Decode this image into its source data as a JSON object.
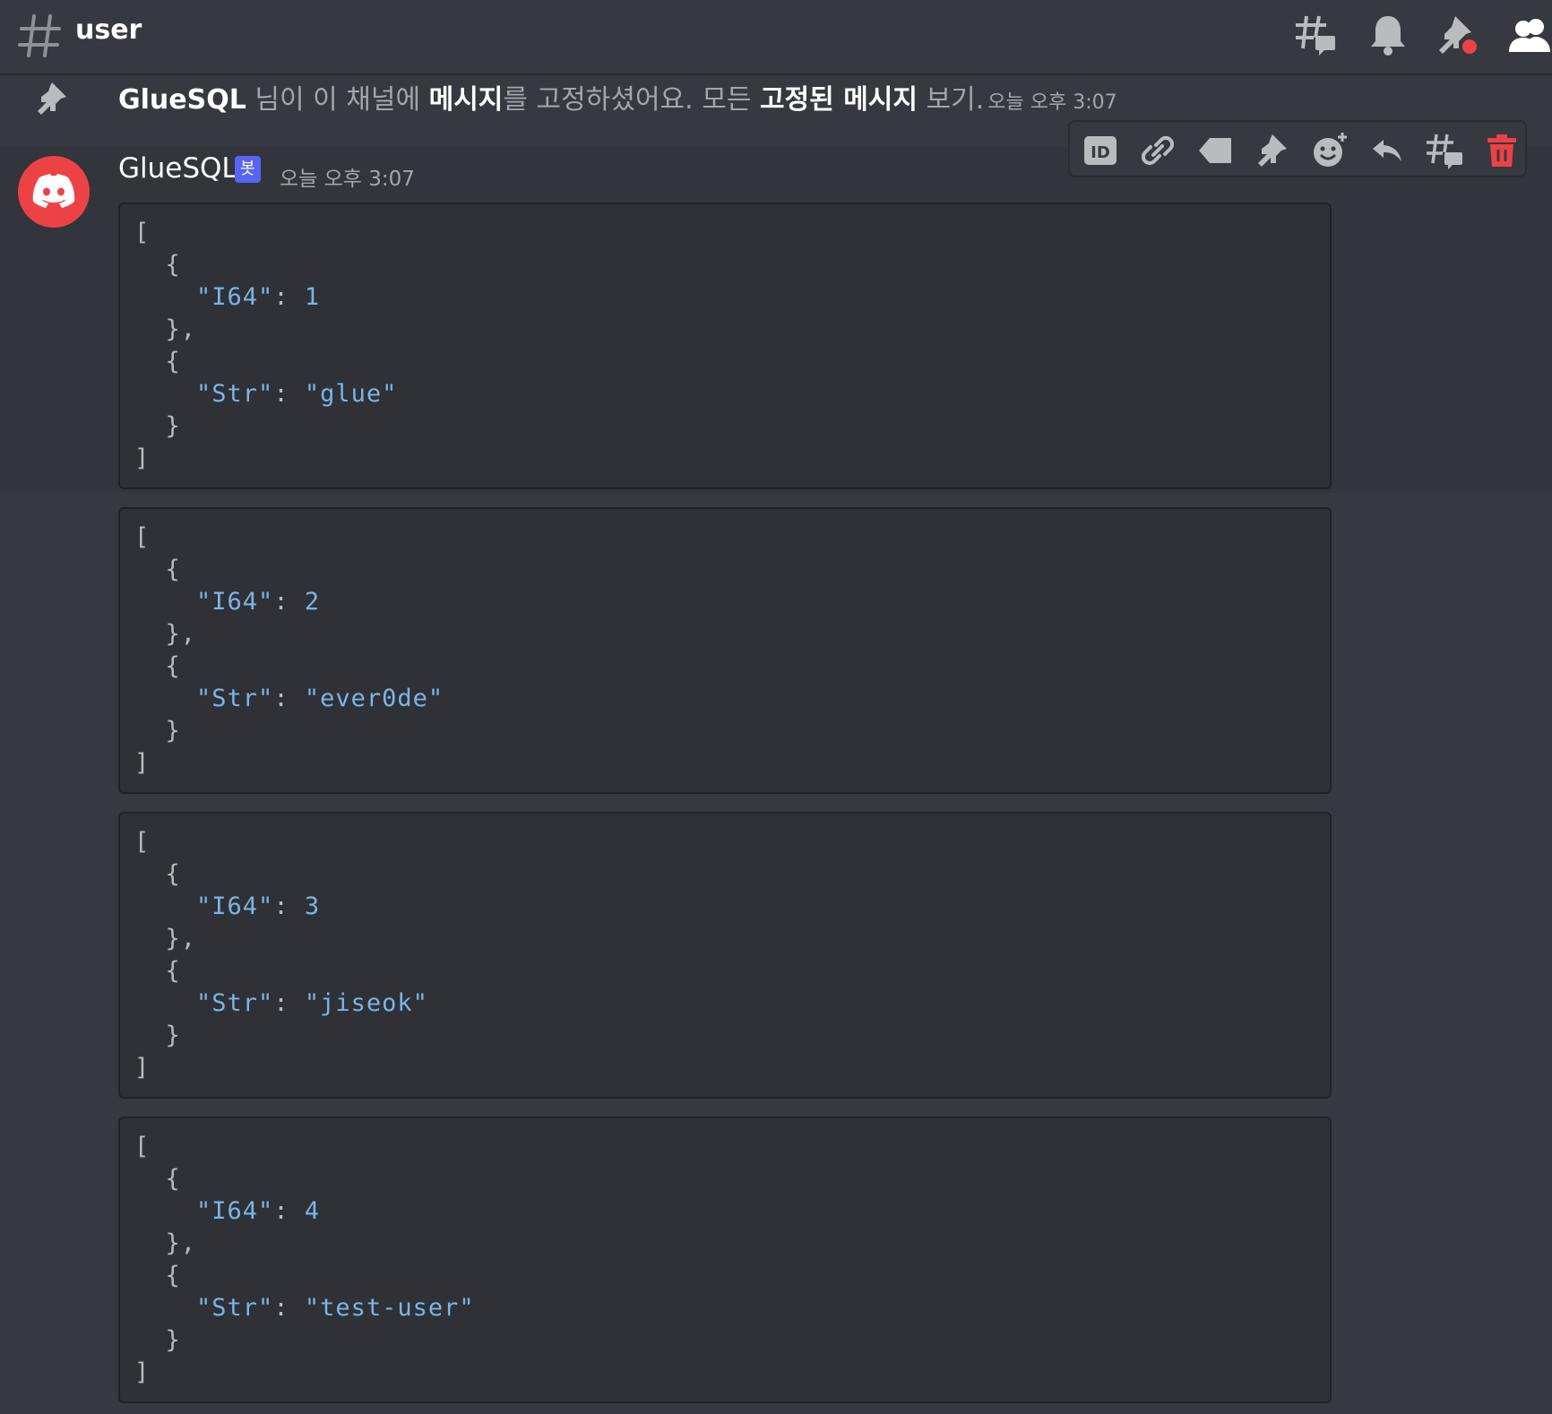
{
  "header": {
    "channel_name": "user"
  },
  "pinned_notice": {
    "author": "GlueSQL",
    "text_1": " 님이 이 채널에 ",
    "link_1": "메시지",
    "text_2": "를 고정하셨어요. 모든 ",
    "link_2": "고정된 메시지",
    "text_3": " 보기.",
    "time": "오늘 오후 3:07"
  },
  "message": {
    "author": "GlueSQL",
    "bot_tag": "봇",
    "time": "오늘 오후 3:07",
    "avatar_color": "#ed4245"
  },
  "toolbar": {
    "icons": [
      "id-icon",
      "link-icon",
      "tag-icon",
      "pin-icon",
      "add-reaction-icon",
      "reply-icon",
      "thread-icon",
      "trash-icon"
    ],
    "danger_color": "#ed4245"
  },
  "code_blocks": [
    {
      "i64_key": "\"I64\"",
      "i64_value": "1",
      "str_key": "\"Str\"",
      "str_value": "\"glue\""
    },
    {
      "i64_key": "\"I64\"",
      "i64_value": "2",
      "str_key": "\"Str\"",
      "str_value": "\"ever0de\""
    },
    {
      "i64_key": "\"I64\"",
      "i64_value": "3",
      "str_key": "\"Str\"",
      "str_value": "\"jiseok\""
    },
    {
      "i64_key": "\"I64\"",
      "i64_value": "4",
      "str_key": "\"Str\"",
      "str_value": "\"test-user\""
    }
  ]
}
